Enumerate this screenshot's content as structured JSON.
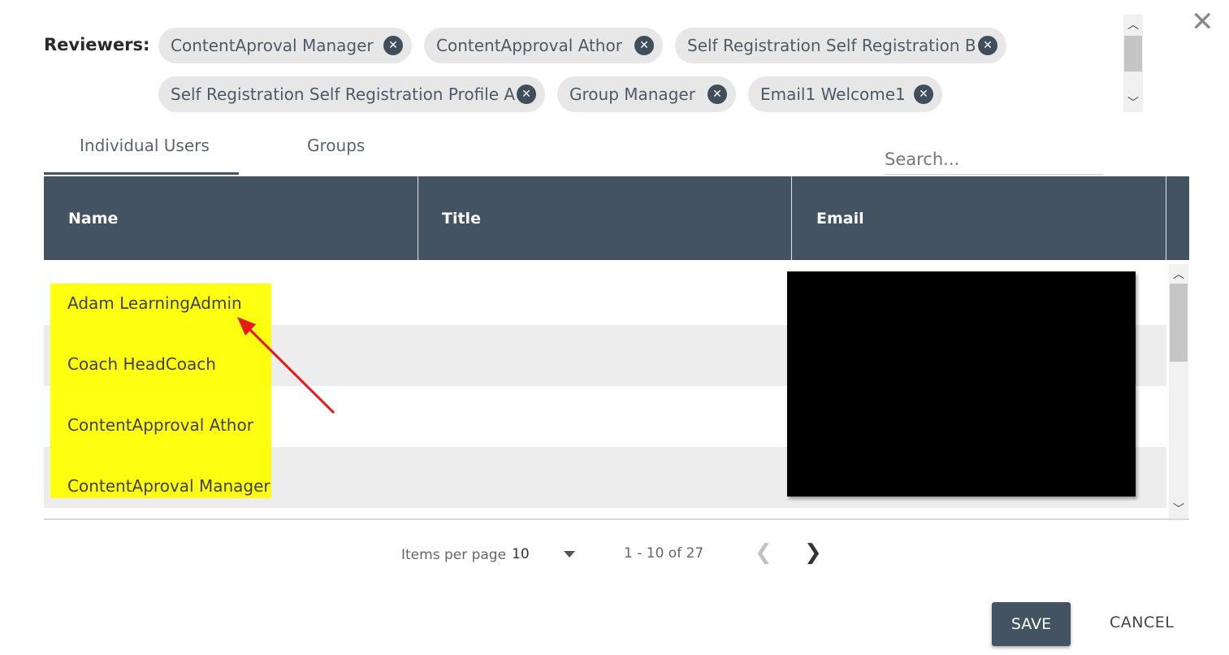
{
  "reviewers": {
    "label": "Reviewers:",
    "chips": [
      {
        "label": "ContentAproval Manager"
      },
      {
        "label": "ContentApproval Athor"
      },
      {
        "label": "Self Registration Self Registration B"
      },
      {
        "label": "Self Registration Self Registration Profile A"
      },
      {
        "label": "Group Manager"
      },
      {
        "label": "Email1 Welcome1"
      }
    ],
    "remove_icon": "close-circle-icon"
  },
  "dialog": {
    "close_icon": "close-icon"
  },
  "tabs": [
    {
      "label": "Individual Users",
      "active": true
    },
    {
      "label": "Groups",
      "active": false
    }
  ],
  "search": {
    "placeholder": "Search...",
    "value": ""
  },
  "table": {
    "columns": [
      "Name",
      "Title",
      "Email"
    ],
    "rows": [
      {
        "name": "Adam LearningAdmin",
        "title": "",
        "email": ""
      },
      {
        "name": "Coach HeadCoach",
        "title": "",
        "email": ""
      },
      {
        "name": "ContentApproval Athor",
        "title": "",
        "email": ""
      },
      {
        "name": "ContentAproval Manager",
        "title": "",
        "email": ""
      }
    ]
  },
  "pagination": {
    "items_per_page_label": "Items per page",
    "items_per_page_value": "10",
    "range": "1 - 10 of 27",
    "prev_icon": "chevron-left-icon",
    "next_icon": "chevron-right-icon"
  },
  "actions": {
    "save": "SAVE",
    "cancel": "CANCEL"
  },
  "colors": {
    "header": "#435361",
    "highlight": "#ffff00",
    "arrow": "#e8191b",
    "chip": "#e7e7e7"
  }
}
